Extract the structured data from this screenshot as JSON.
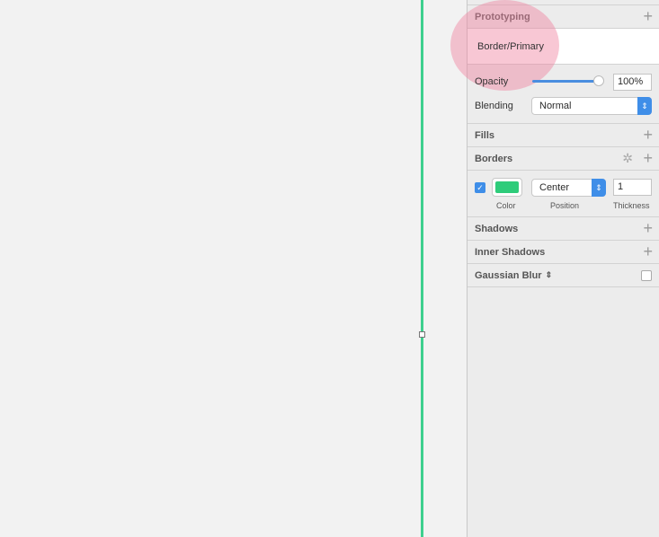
{
  "canvas": {
    "line_color": "#3ecf8e"
  },
  "inspector": {
    "prototyping": {
      "title": "Prototyping",
      "layer_style": "Border/Primary"
    },
    "opacity": {
      "label": "Opacity",
      "value": "100%",
      "level": 1.0
    },
    "blending": {
      "label": "Blending",
      "value": "Normal"
    },
    "fills": {
      "title": "Fills"
    },
    "borders": {
      "title": "Borders",
      "enabled": true,
      "color": "#2ecc7a",
      "position": "Center",
      "thickness": "1",
      "color_label": "Color",
      "position_label": "Position",
      "thickness_label": "Thickness"
    },
    "shadows": {
      "title": "Shadows"
    },
    "inner_shadows": {
      "title": "Inner Shadows"
    },
    "gaussian_blur": {
      "title": "Gaussian Blur",
      "enabled": false
    }
  }
}
